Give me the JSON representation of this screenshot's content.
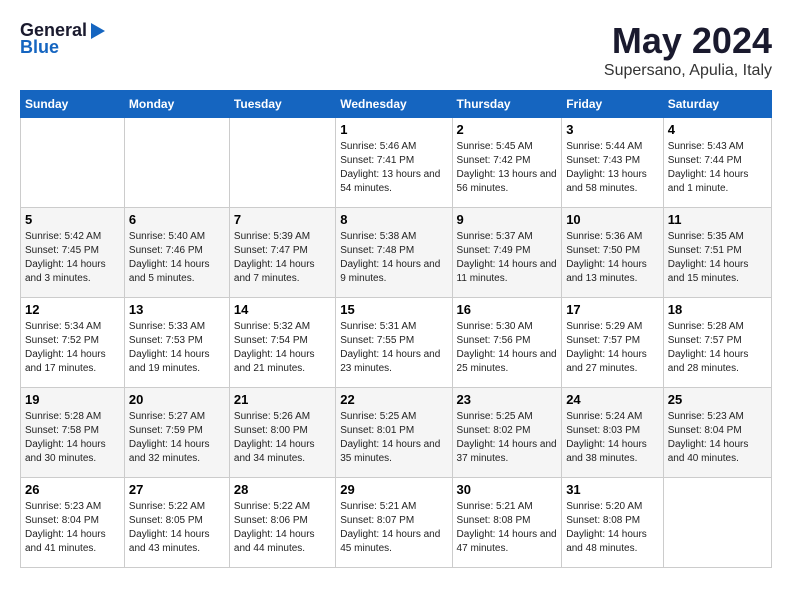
{
  "logo": {
    "general": "General",
    "blue": "Blue"
  },
  "header": {
    "month": "May 2024",
    "location": "Supersano, Apulia, Italy"
  },
  "days_of_week": [
    "Sunday",
    "Monday",
    "Tuesday",
    "Wednesday",
    "Thursday",
    "Friday",
    "Saturday"
  ],
  "weeks": [
    [
      {
        "day": "",
        "content": ""
      },
      {
        "day": "",
        "content": ""
      },
      {
        "day": "",
        "content": ""
      },
      {
        "day": "1",
        "content": "Sunrise: 5:46 AM\nSunset: 7:41 PM\nDaylight: 13 hours and 54 minutes."
      },
      {
        "day": "2",
        "content": "Sunrise: 5:45 AM\nSunset: 7:42 PM\nDaylight: 13 hours and 56 minutes."
      },
      {
        "day": "3",
        "content": "Sunrise: 5:44 AM\nSunset: 7:43 PM\nDaylight: 13 hours and 58 minutes."
      },
      {
        "day": "4",
        "content": "Sunrise: 5:43 AM\nSunset: 7:44 PM\nDaylight: 14 hours and 1 minute."
      }
    ],
    [
      {
        "day": "5",
        "content": "Sunrise: 5:42 AM\nSunset: 7:45 PM\nDaylight: 14 hours and 3 minutes."
      },
      {
        "day": "6",
        "content": "Sunrise: 5:40 AM\nSunset: 7:46 PM\nDaylight: 14 hours and 5 minutes."
      },
      {
        "day": "7",
        "content": "Sunrise: 5:39 AM\nSunset: 7:47 PM\nDaylight: 14 hours and 7 minutes."
      },
      {
        "day": "8",
        "content": "Sunrise: 5:38 AM\nSunset: 7:48 PM\nDaylight: 14 hours and 9 minutes."
      },
      {
        "day": "9",
        "content": "Sunrise: 5:37 AM\nSunset: 7:49 PM\nDaylight: 14 hours and 11 minutes."
      },
      {
        "day": "10",
        "content": "Sunrise: 5:36 AM\nSunset: 7:50 PM\nDaylight: 14 hours and 13 minutes."
      },
      {
        "day": "11",
        "content": "Sunrise: 5:35 AM\nSunset: 7:51 PM\nDaylight: 14 hours and 15 minutes."
      }
    ],
    [
      {
        "day": "12",
        "content": "Sunrise: 5:34 AM\nSunset: 7:52 PM\nDaylight: 14 hours and 17 minutes."
      },
      {
        "day": "13",
        "content": "Sunrise: 5:33 AM\nSunset: 7:53 PM\nDaylight: 14 hours and 19 minutes."
      },
      {
        "day": "14",
        "content": "Sunrise: 5:32 AM\nSunset: 7:54 PM\nDaylight: 14 hours and 21 minutes."
      },
      {
        "day": "15",
        "content": "Sunrise: 5:31 AM\nSunset: 7:55 PM\nDaylight: 14 hours and 23 minutes."
      },
      {
        "day": "16",
        "content": "Sunrise: 5:30 AM\nSunset: 7:56 PM\nDaylight: 14 hours and 25 minutes."
      },
      {
        "day": "17",
        "content": "Sunrise: 5:29 AM\nSunset: 7:57 PM\nDaylight: 14 hours and 27 minutes."
      },
      {
        "day": "18",
        "content": "Sunrise: 5:28 AM\nSunset: 7:57 PM\nDaylight: 14 hours and 28 minutes."
      }
    ],
    [
      {
        "day": "19",
        "content": "Sunrise: 5:28 AM\nSunset: 7:58 PM\nDaylight: 14 hours and 30 minutes."
      },
      {
        "day": "20",
        "content": "Sunrise: 5:27 AM\nSunset: 7:59 PM\nDaylight: 14 hours and 32 minutes."
      },
      {
        "day": "21",
        "content": "Sunrise: 5:26 AM\nSunset: 8:00 PM\nDaylight: 14 hours and 34 minutes."
      },
      {
        "day": "22",
        "content": "Sunrise: 5:25 AM\nSunset: 8:01 PM\nDaylight: 14 hours and 35 minutes."
      },
      {
        "day": "23",
        "content": "Sunrise: 5:25 AM\nSunset: 8:02 PM\nDaylight: 14 hours and 37 minutes."
      },
      {
        "day": "24",
        "content": "Sunrise: 5:24 AM\nSunset: 8:03 PM\nDaylight: 14 hours and 38 minutes."
      },
      {
        "day": "25",
        "content": "Sunrise: 5:23 AM\nSunset: 8:04 PM\nDaylight: 14 hours and 40 minutes."
      }
    ],
    [
      {
        "day": "26",
        "content": "Sunrise: 5:23 AM\nSunset: 8:04 PM\nDaylight: 14 hours and 41 minutes."
      },
      {
        "day": "27",
        "content": "Sunrise: 5:22 AM\nSunset: 8:05 PM\nDaylight: 14 hours and 43 minutes."
      },
      {
        "day": "28",
        "content": "Sunrise: 5:22 AM\nSunset: 8:06 PM\nDaylight: 14 hours and 44 minutes."
      },
      {
        "day": "29",
        "content": "Sunrise: 5:21 AM\nSunset: 8:07 PM\nDaylight: 14 hours and 45 minutes."
      },
      {
        "day": "30",
        "content": "Sunrise: 5:21 AM\nSunset: 8:08 PM\nDaylight: 14 hours and 47 minutes."
      },
      {
        "day": "31",
        "content": "Sunrise: 5:20 AM\nSunset: 8:08 PM\nDaylight: 14 hours and 48 minutes."
      },
      {
        "day": "",
        "content": ""
      }
    ]
  ]
}
